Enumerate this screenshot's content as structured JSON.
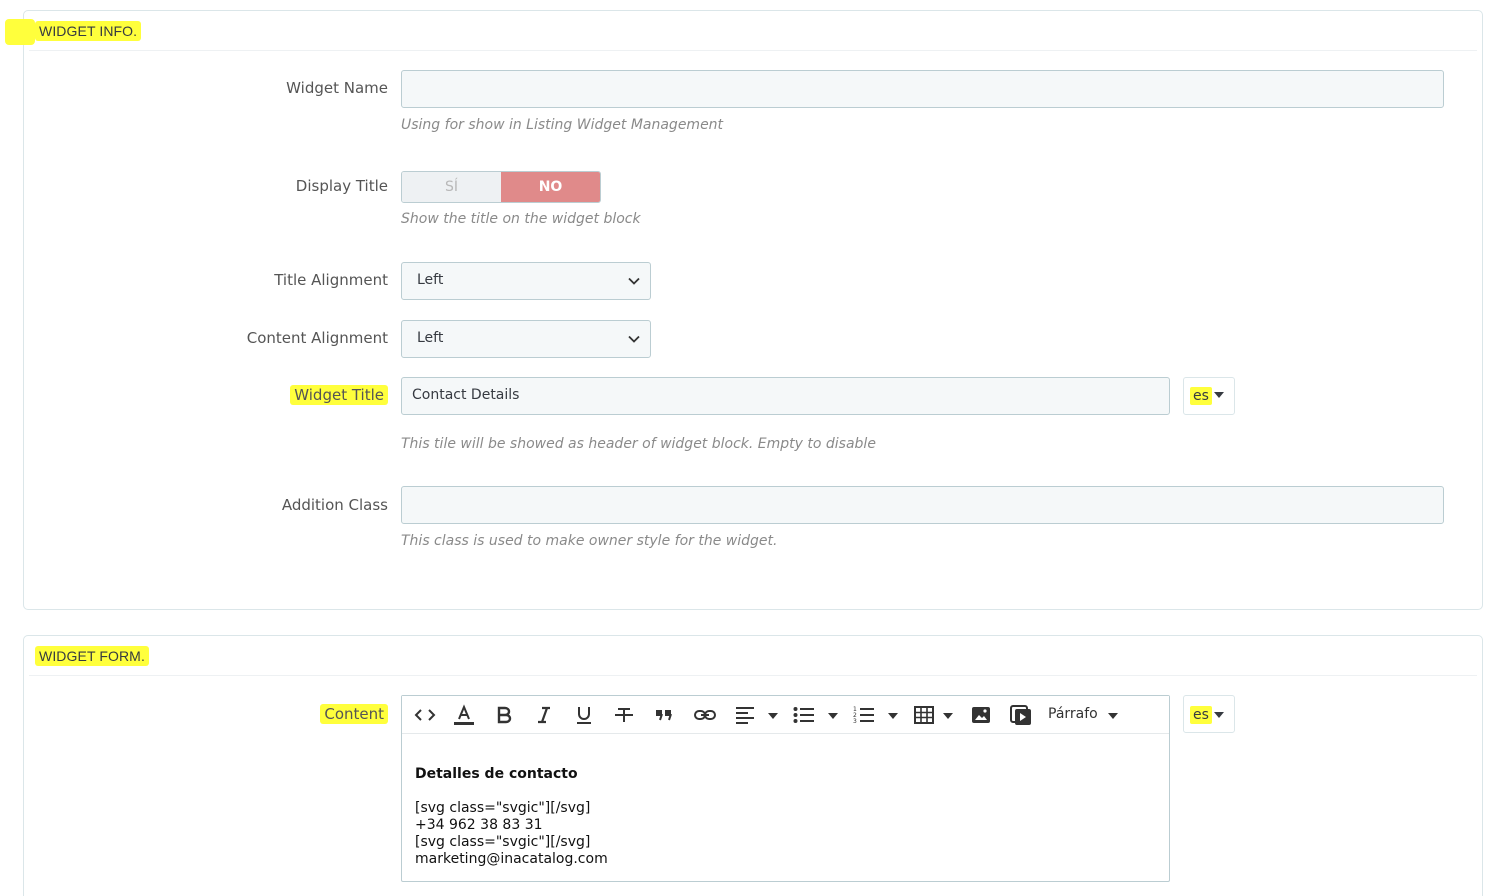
{
  "widget_info": {
    "heading": "WIDGET INFO.",
    "widget_name": {
      "label": "Widget Name",
      "value": "",
      "help": "Using for show in Listing Widget Management"
    },
    "display_title": {
      "label": "Display Title",
      "yes": "SÍ",
      "no": "NO",
      "selected": "NO",
      "help": "Show the title on the widget block"
    },
    "title_alignment": {
      "label": "Title Alignment",
      "value": "Left"
    },
    "content_alignment": {
      "label": "Content Alignment",
      "value": "Left"
    },
    "widget_title": {
      "label": "Widget Title",
      "value": "Contact Details",
      "lang": "es",
      "help": "This tile will be showed as header of widget block. Empty to disable"
    },
    "addition_class": {
      "label": "Addition Class",
      "value": "",
      "help": "This class is used to make owner style for the widget."
    }
  },
  "widget_form": {
    "heading": "WIDGET FORM.",
    "content": {
      "label": "Content",
      "lang": "es",
      "paragraph_format": "Párrafo",
      "body_heading": "Detalles de contacto",
      "body_lines": [
        "[svg class=\"svgic\"][/svg]",
        "+34 962 38 83 31",
        "[svg class=\"svgic\"][/svg]",
        "marketing@inacatalog.com"
      ]
    }
  },
  "colors": {
    "highlight": "#ffff3c",
    "switch_no": "#e08a8a",
    "input_bg": "#f5f8f9",
    "border": "#bbcdd2"
  }
}
